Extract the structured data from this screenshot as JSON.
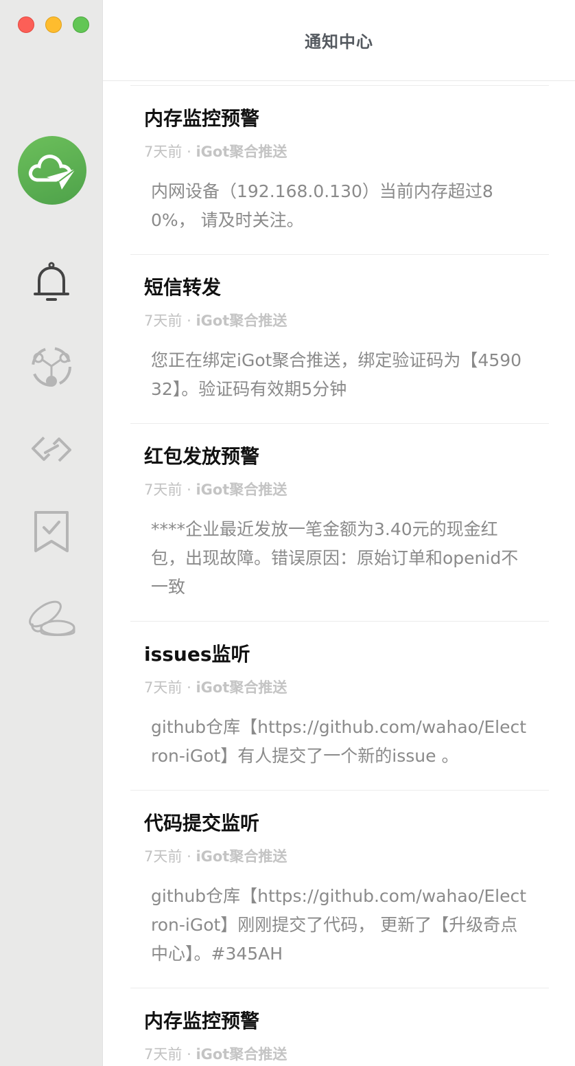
{
  "header": {
    "title": "通知中心"
  },
  "sidebar": {
    "logo": "cloud-paper-plane-logo",
    "items": [
      {
        "icon": "bell-icon",
        "active": true
      },
      {
        "icon": "webhook-icon",
        "active": false
      },
      {
        "icon": "link-icon",
        "active": false
      },
      {
        "icon": "bookmark-check-icon",
        "active": false
      },
      {
        "icon": "coins-icon",
        "active": false
      }
    ]
  },
  "notifications": [
    {
      "title": "内存监控预警",
      "time": "7天前",
      "sep": "·",
      "source": "iGot聚合推送",
      "body": "内网设备（192.168.0.130）当前内存超过80%， 请及时关注。"
    },
    {
      "title": "短信转发",
      "time": "7天前",
      "sep": "·",
      "source": "iGot聚合推送",
      "body": "您正在绑定iGot聚合推送，绑定验证码为【459032】。验证码有效期5分钟"
    },
    {
      "title": "红包发放预警",
      "time": "7天前",
      "sep": "·",
      "source": "iGot聚合推送",
      "body": "****企业最近发放一笔金额为3.40元的现金红包，出现故障。错误原因：原始订单和openid不一致"
    },
    {
      "title": "issues监听",
      "time": "7天前",
      "sep": "·",
      "source": "iGot聚合推送",
      "body": "github仓库【https://github.com/wahao/Electron-iGot】有人提交了一个新的issue 。"
    },
    {
      "title": "代码提交监听",
      "time": "7天前",
      "sep": "·",
      "source": "iGot聚合推送",
      "body": "github仓库【https://github.com/wahao/Electron-iGot】刚刚提交了代码， 更新了【升级奇点中心】。#345AH"
    },
    {
      "title": "内存监控预警",
      "time": "7天前",
      "sep": "·",
      "source": "iGot聚合推送",
      "body": ""
    }
  ],
  "colors": {
    "accent": "#5aaf50",
    "icon_active": "#444444",
    "icon_inactive": "#b5b5b5"
  }
}
